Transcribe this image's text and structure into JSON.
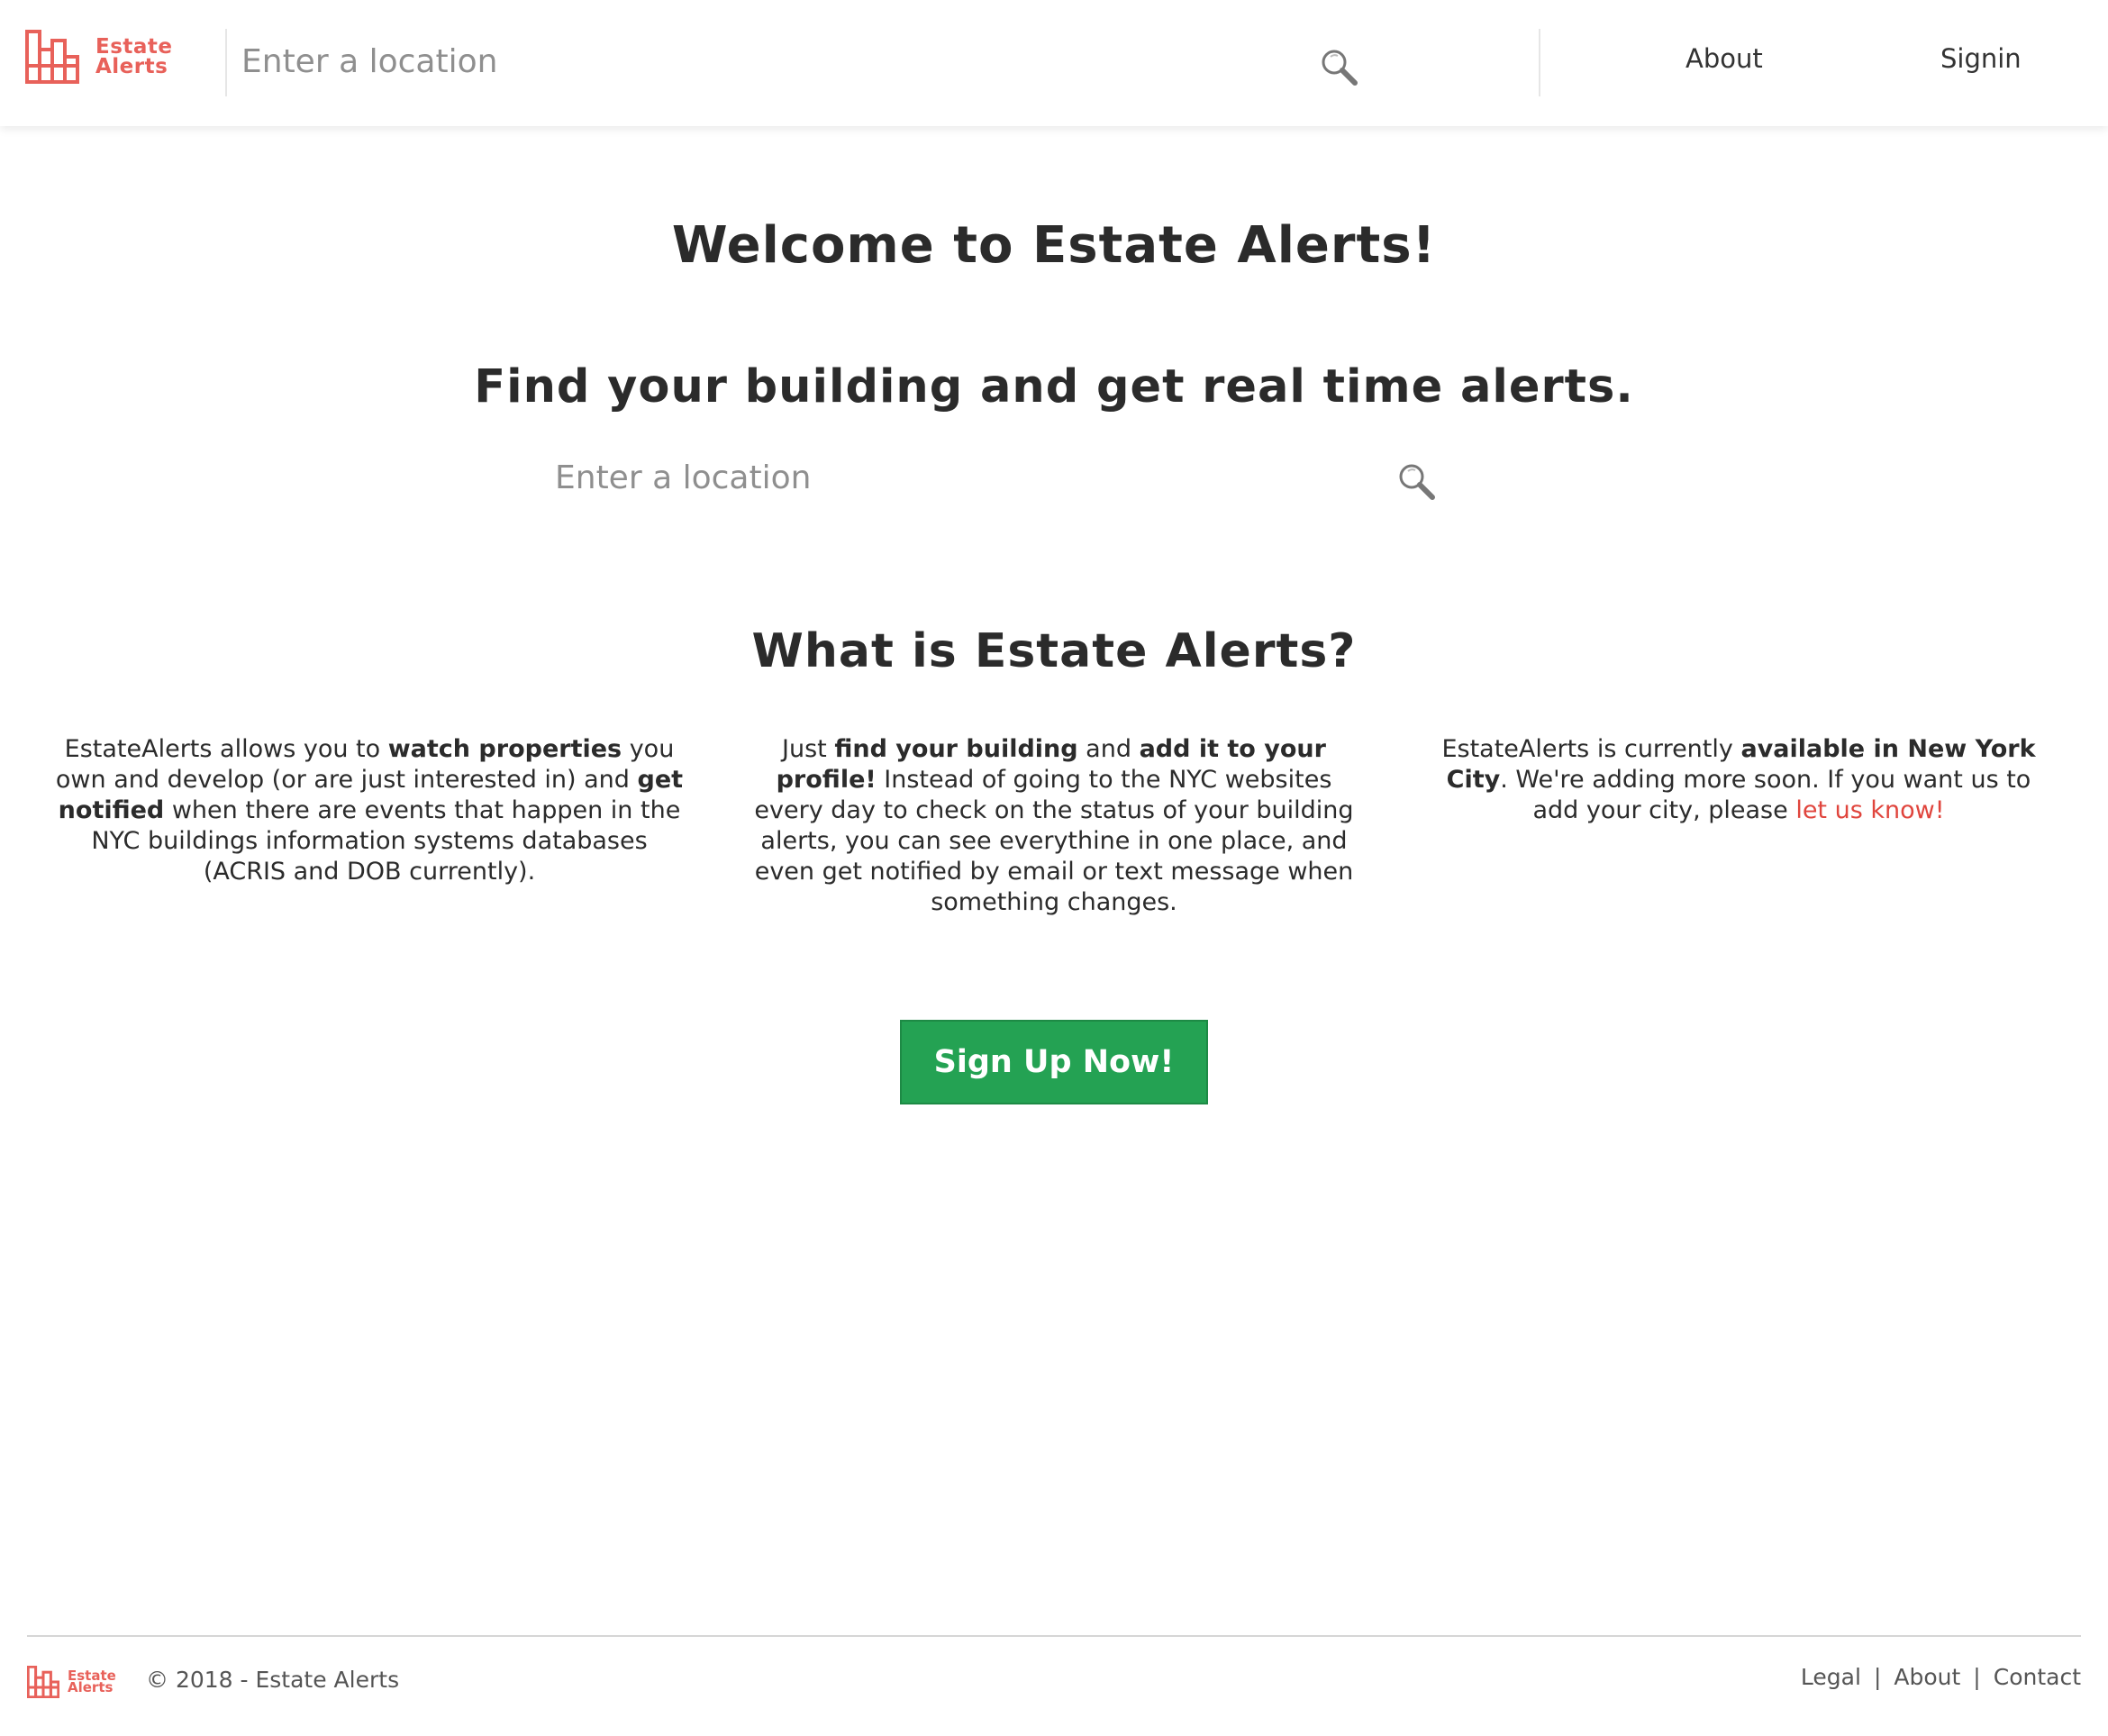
{
  "brand": {
    "name_line1": "Estate",
    "name_line2": "Alerts",
    "color": "#e8615a"
  },
  "header": {
    "search_placeholder": "Enter a location",
    "nav": {
      "about": "About",
      "signin": "Signin"
    }
  },
  "main": {
    "welcome": "Welcome to Estate Alerts!",
    "tagline": "Find your building and get real time alerts.",
    "search_placeholder": "Enter a location",
    "what_is": "What is Estate Alerts?",
    "col1": {
      "t1": "EstateAlerts allows you to ",
      "b1": "watch properties",
      "t2": " you own and develop (or are just interested in) and ",
      "b2": "get notified",
      "t3": " when there are events that happen in the NYC buildings information systems databases (ACRIS and DOB currently)."
    },
    "col2": {
      "t1": "Just ",
      "b1": "find your building",
      "t2": " and ",
      "b2": "add it to your profile!",
      "t3": " Instead of going to the NYC websites every day to check on the status of your building alerts, you can see everythine in one place, and even get notified by email or text message when something changes."
    },
    "col3": {
      "t1": "EstateAlerts is currently ",
      "b1": "available in New York City",
      "t2": ". We're adding more soon. If you want us to add your city, please ",
      "link": "let us know!"
    },
    "signup_label": "Sign Up Now!",
    "signup_color": "#24a253",
    "link_color": "#e0453d"
  },
  "footer": {
    "copyright": "© 2018 - Estate Alerts",
    "links": [
      "Legal",
      "About",
      "Contact"
    ],
    "separator": "|"
  },
  "icons": {
    "logo": "building-logo-icon",
    "search": "magnifier-icon"
  }
}
